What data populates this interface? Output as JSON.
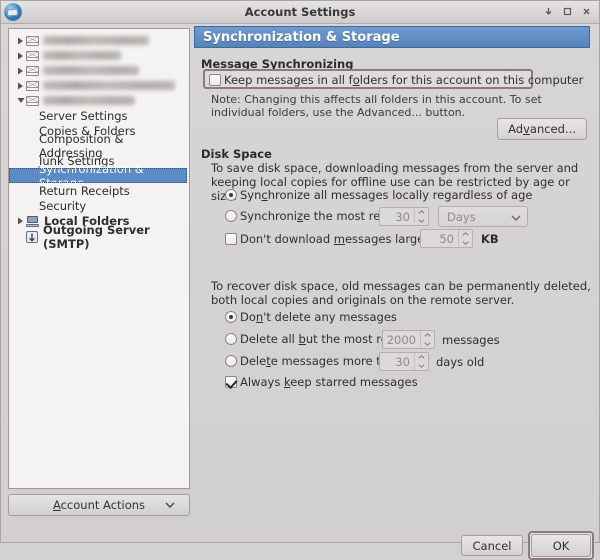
{
  "window": {
    "title": "Account Settings",
    "app_icon": "thunderbird-globe-icon",
    "controls": {
      "minimize": "minimize-icon",
      "maximize": "maximize-icon",
      "close": "close-icon"
    }
  },
  "sidebar": {
    "accounts": [
      {
        "label": "",
        "redacted": true
      },
      {
        "label": "",
        "redacted": true
      },
      {
        "label": "",
        "redacted": true
      },
      {
        "label": "",
        "redacted": true
      },
      {
        "label": "",
        "redacted": true,
        "expanded": true
      }
    ],
    "account_children": [
      {
        "label": "Server Settings",
        "selected": false
      },
      {
        "label": "Copies & Folders",
        "selected": false
      },
      {
        "label": "Composition & Addressing",
        "selected": false
      },
      {
        "label": "Junk Settings",
        "selected": false
      },
      {
        "label": "Synchronization & Storage",
        "selected": true
      },
      {
        "label": "Return Receipts",
        "selected": false
      },
      {
        "label": "Security",
        "selected": false
      }
    ],
    "local_folders": {
      "label": "Local Folders",
      "icon": "computer-icon"
    },
    "outgoing_server": {
      "label": "Outgoing Server (SMTP)",
      "icon": "smtp-arrow-icon"
    },
    "account_actions": {
      "label": "Account Actions",
      "accel": "A",
      "icon": "chevron-down-icon"
    }
  },
  "pane": {
    "header": "Synchronization & Storage",
    "message_sync": {
      "title": "Message Synchronizing",
      "keep_messages": {
        "label_pre": "Keep messages in all f",
        "label_accel": "o",
        "label_post": "lders for this account on this computer",
        "checked": false,
        "focused": true
      },
      "note": "Note: Changing this affects all folders in this account. To set individual folders, use the Advanced... button.",
      "advanced_button": {
        "pre": "Ad",
        "accel": "v",
        "post": "anced..."
      }
    },
    "disk_space": {
      "title": "Disk Space",
      "description": "To save disk space, downloading messages from the server and keeping local copies for offline use can be restricted by age or size.",
      "sync_all": {
        "label_pre": "Syn",
        "label_accel": "c",
        "label_post": "hronize all messages locally regardless of age",
        "selected": true
      },
      "sync_recent": {
        "label_pre": "Synchroni",
        "label_accel": "z",
        "label_post": "e the most recent",
        "selected": false,
        "value": "30",
        "unit": "Days",
        "unit_icon": "chevron-down-icon"
      },
      "max_size": {
        "label_pre": "Don't download ",
        "label_accel": "m",
        "label_post": "essages larger than",
        "checked": false,
        "value": "50",
        "unit": "KB"
      }
    },
    "recover": {
      "description": "To recover disk space, old messages can be permanently deleted, both local copies and originals on the remote server.",
      "dont_delete": {
        "label_pre": "Do",
        "label_accel": "n",
        "label_post": "'t delete any messages",
        "selected": true
      },
      "delete_all_but": {
        "label_pre": "Delete all ",
        "label_accel": "b",
        "label_post": "ut the most recent",
        "selected": false,
        "value": "2000",
        "suffix": "messages"
      },
      "delete_older": {
        "label_pre": "Dele",
        "label_accel": "t",
        "label_post": "e messages more than",
        "selected": false,
        "value": "30",
        "suffix": "days old"
      },
      "keep_starred": {
        "label_pre": "Always ",
        "label_accel": "k",
        "label_post": "eep starred messages",
        "checked": true
      }
    }
  },
  "footer": {
    "cancel": "Cancel",
    "ok": "OK"
  },
  "colors": {
    "header_blue": "#5583bb",
    "selection_blue": "#5b8cc8",
    "window_bg": "#d4d2d0",
    "panel_bg": "#f4f3f2",
    "default_button_frame": "#8c7a7d"
  }
}
